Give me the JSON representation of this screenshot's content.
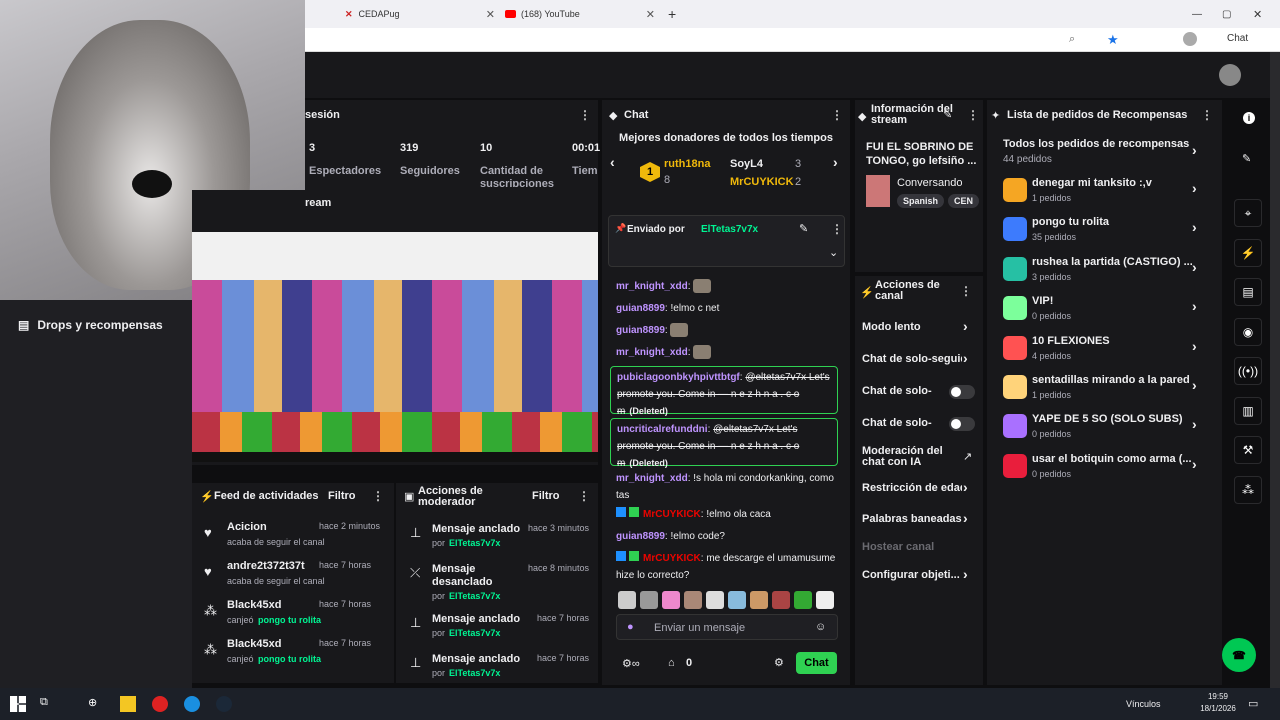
{
  "browser": {
    "tabs": [
      {
        "label": "CEDAPug"
      },
      {
        "label": "(168) YouTube"
      }
    ],
    "chat_btn": "Chat"
  },
  "sidebar": {
    "drops": "Drops y recompensas"
  },
  "stats": {
    "header": "sesión",
    "values": [
      {
        "v": "3",
        "l": "Espectadores"
      },
      {
        "v": "319",
        "l": "Seguidores"
      },
      {
        "v": "10",
        "l": "Cantidad de suscripciones"
      },
      {
        "v": "00:01",
        "l": "Tiem"
      }
    ],
    "preview_header": "ream"
  },
  "activity": {
    "title": "Feed de actividades",
    "filter": "Filtro",
    "items": [
      {
        "name": "Acicion",
        "time": "hace 2 minutos",
        "desc": "acaba de seguir el canal",
        "reward": ""
      },
      {
        "name": "andre2t372t37t",
        "time": "hace 7 horas",
        "desc": "acaba de seguir el canal",
        "reward": ""
      },
      {
        "name": "Black45xd",
        "time": "hace 7 horas",
        "desc": "canjeó",
        "reward": "pongo tu rolita"
      },
      {
        "name": "Black45xd",
        "time": "hace 7 horas",
        "desc": "canjeó",
        "reward": "pongo tu rolita"
      }
    ]
  },
  "modactions": {
    "title": "Acciones de moderador",
    "filter": "Filtro",
    "items": [
      {
        "action": "Mensaje anclado",
        "time": "hace 3 minutos",
        "by": "por",
        "user": "ElTetas7v7x"
      },
      {
        "action": "Mensaje desanclado",
        "time": "hace 8 minutos",
        "by": "por",
        "user": "ElTetas7v7x"
      },
      {
        "action": "Mensaje anclado",
        "time": "hace 7 horas",
        "by": "por",
        "user": "ElTetas7v7x"
      },
      {
        "action": "Mensaje anclado",
        "time": "hace 7 horas",
        "by": "por",
        "user": "ElTetas7v7x"
      }
    ]
  },
  "chat": {
    "title": "Chat",
    "donors_title": "Mejores donadores de todos los tiempos",
    "donors": [
      {
        "name": "ruth18na",
        "count": "8"
      },
      {
        "name": "SoyL4",
        "count": "3"
      },
      {
        "name": "MrCUYKICK",
        "count": "2"
      }
    ],
    "rank": "1",
    "pinned_by": "Enviado por",
    "pinned_user": "ElTetas7v7x",
    "messages": [
      {
        "user": "mr_knight_xdd",
        "text": ""
      },
      {
        "user": "guian8899",
        "text": "!elmo c net"
      },
      {
        "user": "guian8899",
        "text": ""
      },
      {
        "user": "mr_knight_xdd",
        "text": ""
      },
      {
        "user": "pubiclagoonbkyhpivttbtgf",
        "text": "@eltetas7v7x Let's promote you. Come in — n e z h n a . c o m",
        "deleted": "(Deleted)"
      },
      {
        "user": "uncriticalrefunddni",
        "text": "@eltetas7v7x Let's promote you. Come in — n e z h n a . c o m",
        "deleted": "(Deleted)"
      },
      {
        "user": "mr_knight_xdd",
        "text": "!s hola mi condorkanking, como tas"
      },
      {
        "user": "MrCUYKICK",
        "text": "!elmo ola caca"
      },
      {
        "user": "guian8899",
        "text": "!elmo code?"
      },
      {
        "user": "MrCUYKICK",
        "text": "me descarge el umamusume hize lo correcto?"
      }
    ],
    "input_placeholder": "Enviar un mensaje",
    "points": "0",
    "send": "Chat"
  },
  "info": {
    "title": "Información del stream",
    "stream_title": "FUI EL SOBRINO DE TONGO, go lefsiño ...",
    "category": "Conversando",
    "tags": [
      "Spanish",
      "CEN"
    ]
  },
  "channel_actions": {
    "title": "Acciones de canal",
    "items": [
      "Modo lento",
      "Chat de solo-seguid",
      "Chat de solo-...",
      "Chat de solo-...",
      "Moderación del chat con IA",
      "Restricción de edad",
      "Palabras baneadas",
      "Hostear canal",
      "Configurar objeti..."
    ]
  },
  "rewards": {
    "title": "Lista de pedidos de Recompensas",
    "all": "Todos los pedidos de recompensas",
    "all_count": "44 pedidos",
    "items": [
      {
        "name": "denegar mi tanksito :,v",
        "count": "1 pedidos",
        "color": "#f5a623"
      },
      {
        "name": "pongo tu rolita",
        "count": "35 pedidos",
        "color": "#3d7bfd"
      },
      {
        "name": "rushea la partida (CASTIGO) ...",
        "count": "3 pedidos",
        "color": "#26c0a4"
      },
      {
        "name": "VIP!",
        "count": "0 pedidos",
        "color": "#7cff9b"
      },
      {
        "name": "10 FLEXIONES",
        "count": "4 pedidos",
        "color": "#ff5252"
      },
      {
        "name": "sentadillas mirando a la pared",
        "count": "1 pedidos",
        "color": "#ffd37a"
      },
      {
        "name": "YAPE DE 5 SO (SOLO SUBS)",
        "count": "0 pedidos",
        "color": "#a970ff"
      },
      {
        "name": "usar el botiquin como arma (...",
        "count": "0 pedidos",
        "color": "#e91e3c"
      }
    ]
  },
  "taskbar": {
    "links": "Vínculos",
    "time": "19:59",
    "date": "18/1/2026"
  }
}
